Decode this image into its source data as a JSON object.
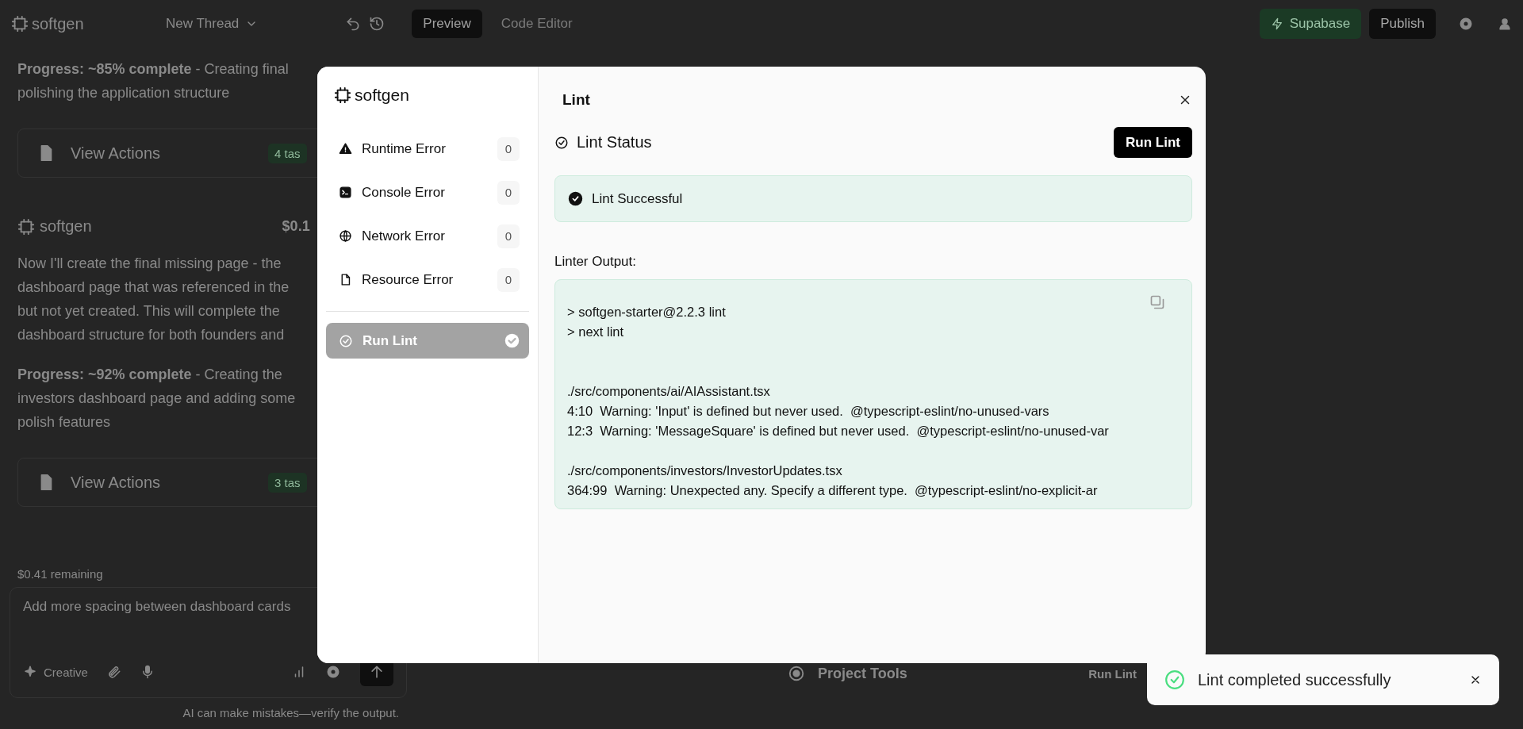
{
  "top_bar": {
    "logo": "softgen",
    "thread": "New Thread",
    "tabs": [
      {
        "label": "Preview",
        "selected": true
      },
      {
        "label": "Code Editor",
        "selected": false
      }
    ],
    "buttons": [
      {
        "label": "Supabase",
        "kind": "supabase"
      },
      {
        "label": "Publish",
        "kind": "primary"
      }
    ]
  },
  "chat": {
    "messages": [
      {
        "kind": "text",
        "lines": [
          "**Progress: ~85% complete** - Creating final",
          "polishing the application structure"
        ]
      },
      {
        "kind": "actions",
        "label": "View Actions",
        "badge": "4 tas"
      },
      {
        "kind": "author",
        "name": "softgen",
        "cost": "$0.1"
      },
      {
        "kind": "text",
        "lines": [
          "Now I'll create the final missing page - the",
          "dashboard page that was referenced in the",
          "but not yet created. This will complete the",
          "dashboard structure for both founders and"
        ]
      },
      {
        "kind": "text",
        "lines": [
          "**Progress: ~92% complete** - Creating the",
          "investors dashboard page and adding some",
          "polish features"
        ]
      },
      {
        "kind": "actions",
        "label": "View Actions",
        "badge": "3 tas"
      }
    ],
    "remaining": "$0.41 remaining",
    "input": "Add more spacing between dashboard cards",
    "mode": "Creative",
    "footer": "AI can make mistakes—verify the output."
  },
  "project_tools": {
    "label": "Project Tools",
    "action": "Run Lint"
  },
  "modal": {
    "logo": "softgen",
    "title": "Lint",
    "sidebar": {
      "items": [
        {
          "kind": "error",
          "label": "Runtime Error",
          "count": "0",
          "selected": false
        },
        {
          "kind": "error",
          "label": "Console Error",
          "count": "0",
          "selected": false
        },
        {
          "kind": "error",
          "label": "Network Error",
          "count": "0",
          "selected": false
        },
        {
          "kind": "error",
          "label": "Resource Error",
          "count": "0",
          "selected": false
        },
        {
          "kind": "action",
          "label": "Run Lint",
          "selected": true,
          "done": true
        }
      ]
    },
    "status_heading": "Lint Status",
    "run_button": "Run Lint",
    "status": {
      "text": "Lint Successful",
      "success": true
    },
    "output_label": "Linter Output:",
    "output": "> softgen-starter@2.2.3 lint\n> next lint\n\n\n./src/components/ai/AIAssistant.tsx\n4:10  Warning: 'Input' is defined but never used.  @typescript-eslint/no-unused-vars\n12:3  Warning: 'MessageSquare' is defined but never used.  @typescript-eslint/no-unused-var\n\n./src/components/investors/InvestorUpdates.tsx\n364:99  Warning: Unexpected any. Specify a different type.  @typescript-eslint/no-explicit-ar"
  },
  "toast": {
    "text": "Lint completed successfully"
  }
}
